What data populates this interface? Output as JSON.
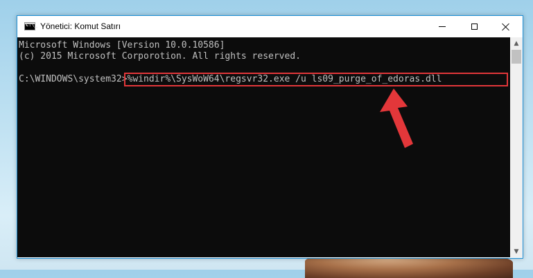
{
  "window": {
    "title": "Yönetici: Komut Satırı",
    "controls": {
      "minimize": "minimize",
      "maximize": "maximize",
      "close": "close"
    }
  },
  "console": {
    "line1": "Microsoft Windows [Version 10.0.10586]",
    "line2": "(c) 2015 Microsoft Corporotion. All rights reserved.",
    "prompt": "C:\\WINDOWS\\system32>",
    "command": "%windir%\\SysWoW64\\regsvr32.exe /u ls09_purge_of_edoras.dll"
  },
  "colors": {
    "console_bg": "#0c0c0c",
    "console_text": "#c0c0c0",
    "highlight": "#e3373a",
    "arrow": "#e3373a"
  },
  "icons": {
    "app": "cmd-icon",
    "scroll_up": "chevron-up-icon",
    "scroll_down": "chevron-down-icon",
    "annotation": "red-arrow-icon"
  }
}
